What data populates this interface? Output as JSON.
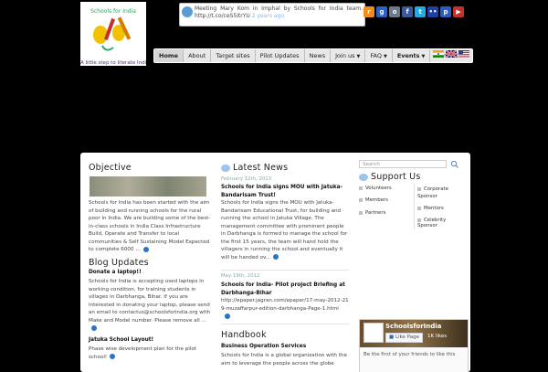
{
  "logo": {
    "alt": "Schools for India",
    "tagline": "A little step to literate India"
  },
  "tweet": {
    "text": "Meeting Mary Kom in Imphal by Schools for India team. http://t.co/ceS5itrYU",
    "time": "2 years ago"
  },
  "social": [
    {
      "name": "rss-icon",
      "color": "#f28c1d",
      "glyph": "r"
    },
    {
      "name": "google-icon",
      "color": "#2b63c4",
      "glyph": "g"
    },
    {
      "name": "linkedin-icon",
      "color": "#6c7a8a",
      "glyph": "o"
    },
    {
      "name": "facebook-icon",
      "color": "#3b5998",
      "glyph": "f"
    },
    {
      "name": "twitter-icon",
      "color": "#2aa9e0",
      "glyph": "t"
    },
    {
      "name": "flickr-icon",
      "color": "#1f3fa8",
      "glyph": "••"
    },
    {
      "name": "picasa-icon",
      "color": "#2e5bbf",
      "glyph": "p"
    },
    {
      "name": "youtube-icon",
      "color": "#c4302b",
      "glyph": "▶"
    }
  ],
  "nav": [
    {
      "label": "Home",
      "active": true,
      "caret": false
    },
    {
      "label": "About",
      "active": false,
      "caret": false
    },
    {
      "label": "Target sites",
      "active": false,
      "caret": false
    },
    {
      "label": "Pilot Updates",
      "active": false,
      "caret": false
    },
    {
      "label": "News",
      "active": false,
      "caret": false
    },
    {
      "label": "Join us",
      "active": false,
      "caret": true
    },
    {
      "label": "FAQ",
      "active": false,
      "caret": true
    },
    {
      "label": "Events",
      "active": false,
      "caret": true,
      "bold": true
    },
    {
      "label": "Contact",
      "active": false,
      "caret": false
    }
  ],
  "flags": [
    "india-flag-icon",
    "uk-flag-icon",
    "us-flag-icon"
  ],
  "objective": {
    "title": "Objective",
    "text": "Schools for India has been started with the aim of building and running schools for the rural poor in India. We are building some of the best-in-class schools in India Class Infrastructure Build, Operate and Transfer to local communities & Self Sustaining Model Expected to complete 6000 ..."
  },
  "blog": {
    "title": "Blog Updates",
    "posts": [
      {
        "title": "Donate a laptop!!",
        "text": "Schools for India is accepting used laptops in working condition, for training students in villages in Darbhanga, Bihar. If you are interested in donating your laptop, please send an email to contactus@schoolsforindia.org with Make and Model number. Please remove all ..."
      },
      {
        "title": "Jatuka School Layout!",
        "text": "Phase wise development plan for the pilot school!"
      }
    ]
  },
  "news": {
    "title": "Latest News",
    "items": [
      {
        "date": "February 12th, 2013",
        "title": "Schools for India signs MOU with Jatuka-Bandarisam Trust!",
        "text": "Schools for India signs the MOU with Jatuka-Bandarisam Educational Trust, for building and running the school in Jatuka Village. The management committee with prominent people in Darbhanga is formed to manage the school for the first 15 years, the team will hand hold the villagers in running the school and eventually it will be handed ov..."
      },
      {
        "date": "May 19th, 2012",
        "title": "Schools for India- Pilot project Briefing at Darbhanga-Bihar",
        "text": "http://epaper.jagran.com/epaper/17-may-2012-219-muzaffarpur-edition-darbhanga-Page-1.html"
      }
    ]
  },
  "handbook": {
    "title": "Handbook",
    "subtitle": "Business Operation Services",
    "text": "Schools for India is a global organization with the aim to leverage the people across the globe"
  },
  "search": {
    "placeholder": "Search"
  },
  "support": {
    "title": "Support Us",
    "left": [
      "Volunteers",
      "Members",
      "Partners"
    ],
    "right": [
      "Corporate Sponsor",
      "Mentors",
      "Celebrity Sponsor"
    ]
  },
  "facebook": {
    "page_name": "SchoolsforIndia",
    "like_label": "Like Page",
    "likes": "1K likes",
    "friends_text": "Be the first of your friends to like this"
  }
}
